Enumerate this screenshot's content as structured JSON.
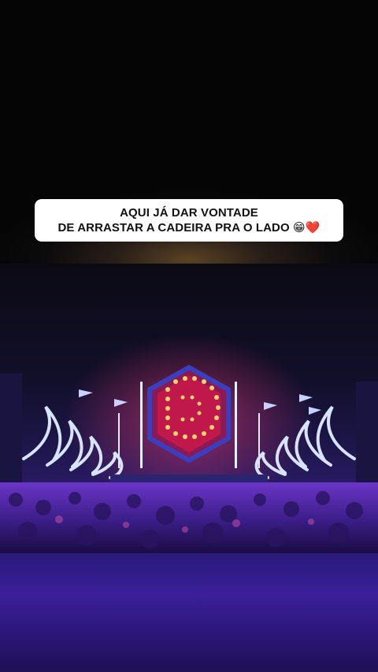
{
  "caption": {
    "line1": "AQUI JÁ DAR VONTADE",
    "line2": "DE ARRASTAR A CADEIRA PRA O LADO 😁❤️"
  },
  "scene": {
    "subject": "concert-stage-crowd",
    "colors": {
      "stage_glow": "#ffcc55",
      "stage_screen": "#c0184a",
      "crowd": "#5a2fb0",
      "flames": "#d8e4ff",
      "bottom_fill": "#3a1f99"
    }
  }
}
